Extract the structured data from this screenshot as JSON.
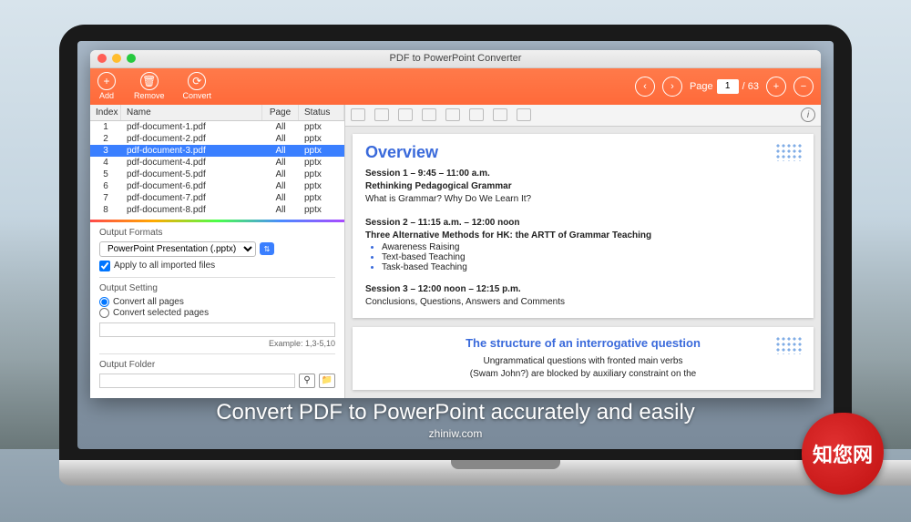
{
  "window": {
    "title": "PDF to PowerPoint Converter"
  },
  "toolbar": {
    "add": "Add",
    "remove": "Remove",
    "convert": "Convert",
    "page_label": "Page",
    "page_current": "1",
    "page_total": "/ 63"
  },
  "table": {
    "headers": {
      "index": "Index",
      "name": "Name",
      "page": "Page",
      "status": "Status"
    },
    "rows": [
      {
        "index": "1",
        "name": "pdf-document-1.pdf",
        "page": "All",
        "status": "pptx"
      },
      {
        "index": "2",
        "name": "pdf-document-2.pdf",
        "page": "All",
        "status": "pptx"
      },
      {
        "index": "3",
        "name": "pdf-document-3.pdf",
        "page": "All",
        "status": "pptx"
      },
      {
        "index": "4",
        "name": "pdf-document-4.pdf",
        "page": "All",
        "status": "pptx"
      },
      {
        "index": "5",
        "name": "pdf-document-5.pdf",
        "page": "All",
        "status": "pptx"
      },
      {
        "index": "6",
        "name": "pdf-document-6.pdf",
        "page": "All",
        "status": "pptx"
      },
      {
        "index": "7",
        "name": "pdf-document-7.pdf",
        "page": "All",
        "status": "pptx"
      },
      {
        "index": "8",
        "name": "pdf-document-8.pdf",
        "page": "All",
        "status": "pptx"
      }
    ],
    "selected_index": 2
  },
  "formats": {
    "title": "Output Formats",
    "selected": "PowerPoint Presentation (.pptx)",
    "apply_all": "Apply to all imported files"
  },
  "output_setting": {
    "title": "Output Setting",
    "convert_all": "Convert all pages",
    "convert_selected": "Convert selected pages",
    "example": "Example: 1,3-5,10"
  },
  "output_folder": {
    "title": "Output Folder"
  },
  "preview": {
    "slide1": {
      "title": "Overview",
      "s1_head": "Session 1 –  9:45 – 11:00 a.m.",
      "s1_sub": "Rethinking Pedagogical Grammar",
      "s1_body": "What is Grammar? Why Do We Learn It?",
      "s2_head": "Session 2 – 11:15 a.m. – 12:00 noon",
      "s2_sub": "Three Alternative Methods for HK: the ARTT of Grammar Teaching",
      "s2_b1": "Awareness Raising",
      "s2_b2": "Text-based Teaching",
      "s2_b3": "Task-based Teaching",
      "s3_head": "Session 3 – 12:00 noon – 12:15 p.m.",
      "s3_body": "Conclusions, Questions, Answers and Comments"
    },
    "slide2": {
      "title": "The structure of an interrogative question",
      "body1": "Ungrammatical questions with fronted main verbs",
      "body2": "(Swam John?) are blocked by auxiliary constraint on the"
    }
  },
  "caption": {
    "main": "Convert PDF to PowerPoint accurately and easily",
    "sub": "zhiniw.com"
  },
  "stamp": "知您网"
}
